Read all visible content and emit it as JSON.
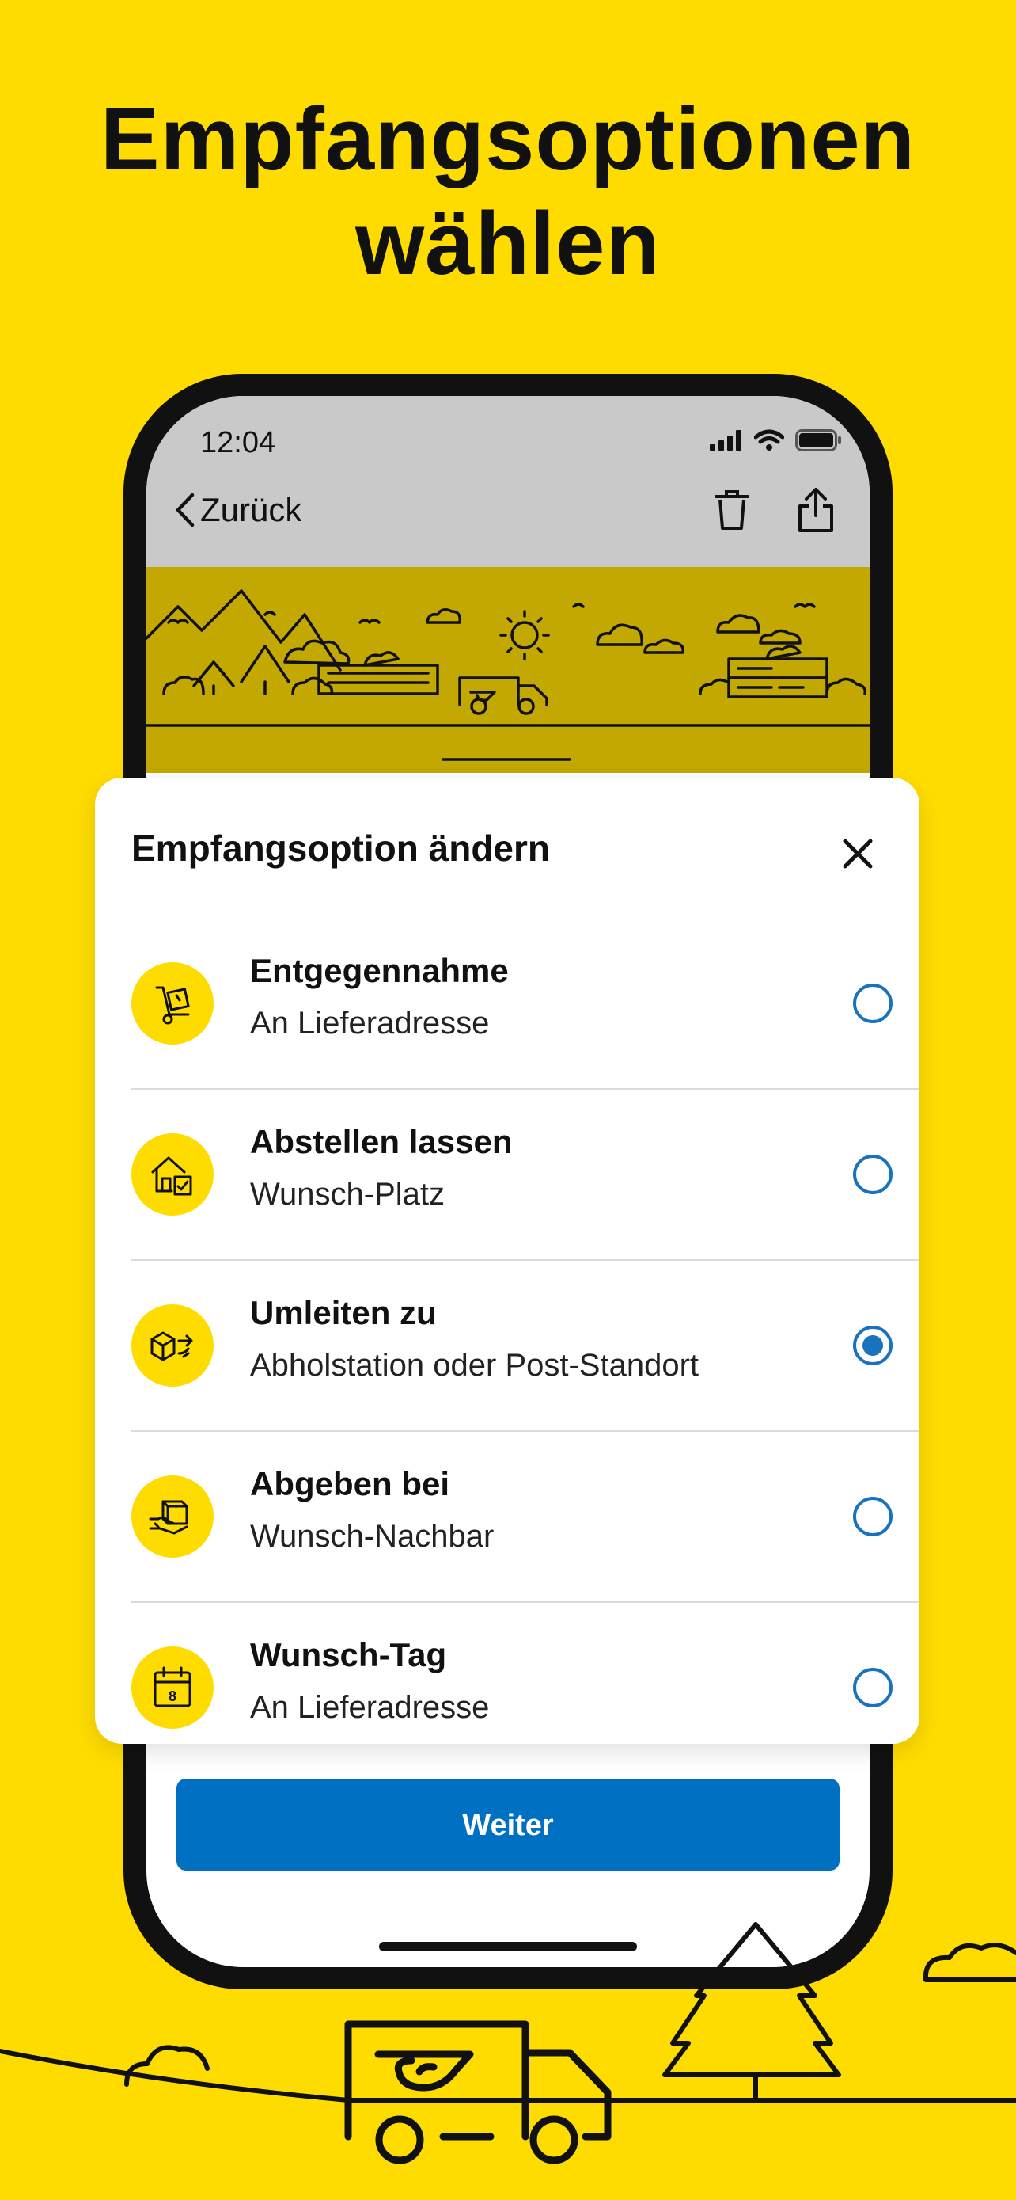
{
  "headline": {
    "line1": "Empfangsoptionen",
    "line2": "wählen"
  },
  "statusbar": {
    "time": "12:04"
  },
  "navbar": {
    "back_label": "Zurück"
  },
  "sheet": {
    "title": "Empfangsoption ändern",
    "options": [
      {
        "title": "Entgegennahme",
        "subtitle": "An Lieferadresse",
        "icon": "hand-truck-icon",
        "selected": false
      },
      {
        "title": "Abstellen lassen",
        "subtitle": "Wunsch-Platz",
        "icon": "house-package-icon",
        "selected": false
      },
      {
        "title": "Umleiten zu",
        "subtitle": "Abholstation oder Post-Standort",
        "icon": "package-redirect-icon",
        "selected": true
      },
      {
        "title": "Abgeben bei",
        "subtitle": "Wunsch-Nachbar",
        "icon": "hand-package-icon",
        "selected": false
      },
      {
        "title": "Wunsch-Tag",
        "subtitle": "An Lieferadresse",
        "icon": "calendar-icon",
        "selected": false
      }
    ],
    "calendar_day": "8"
  },
  "primary_button": {
    "label": "Weiter"
  },
  "colors": {
    "background": "#FFDC00",
    "accent": "#0071C2",
    "radio": "#1A72BF",
    "banner": "#C2A800"
  }
}
